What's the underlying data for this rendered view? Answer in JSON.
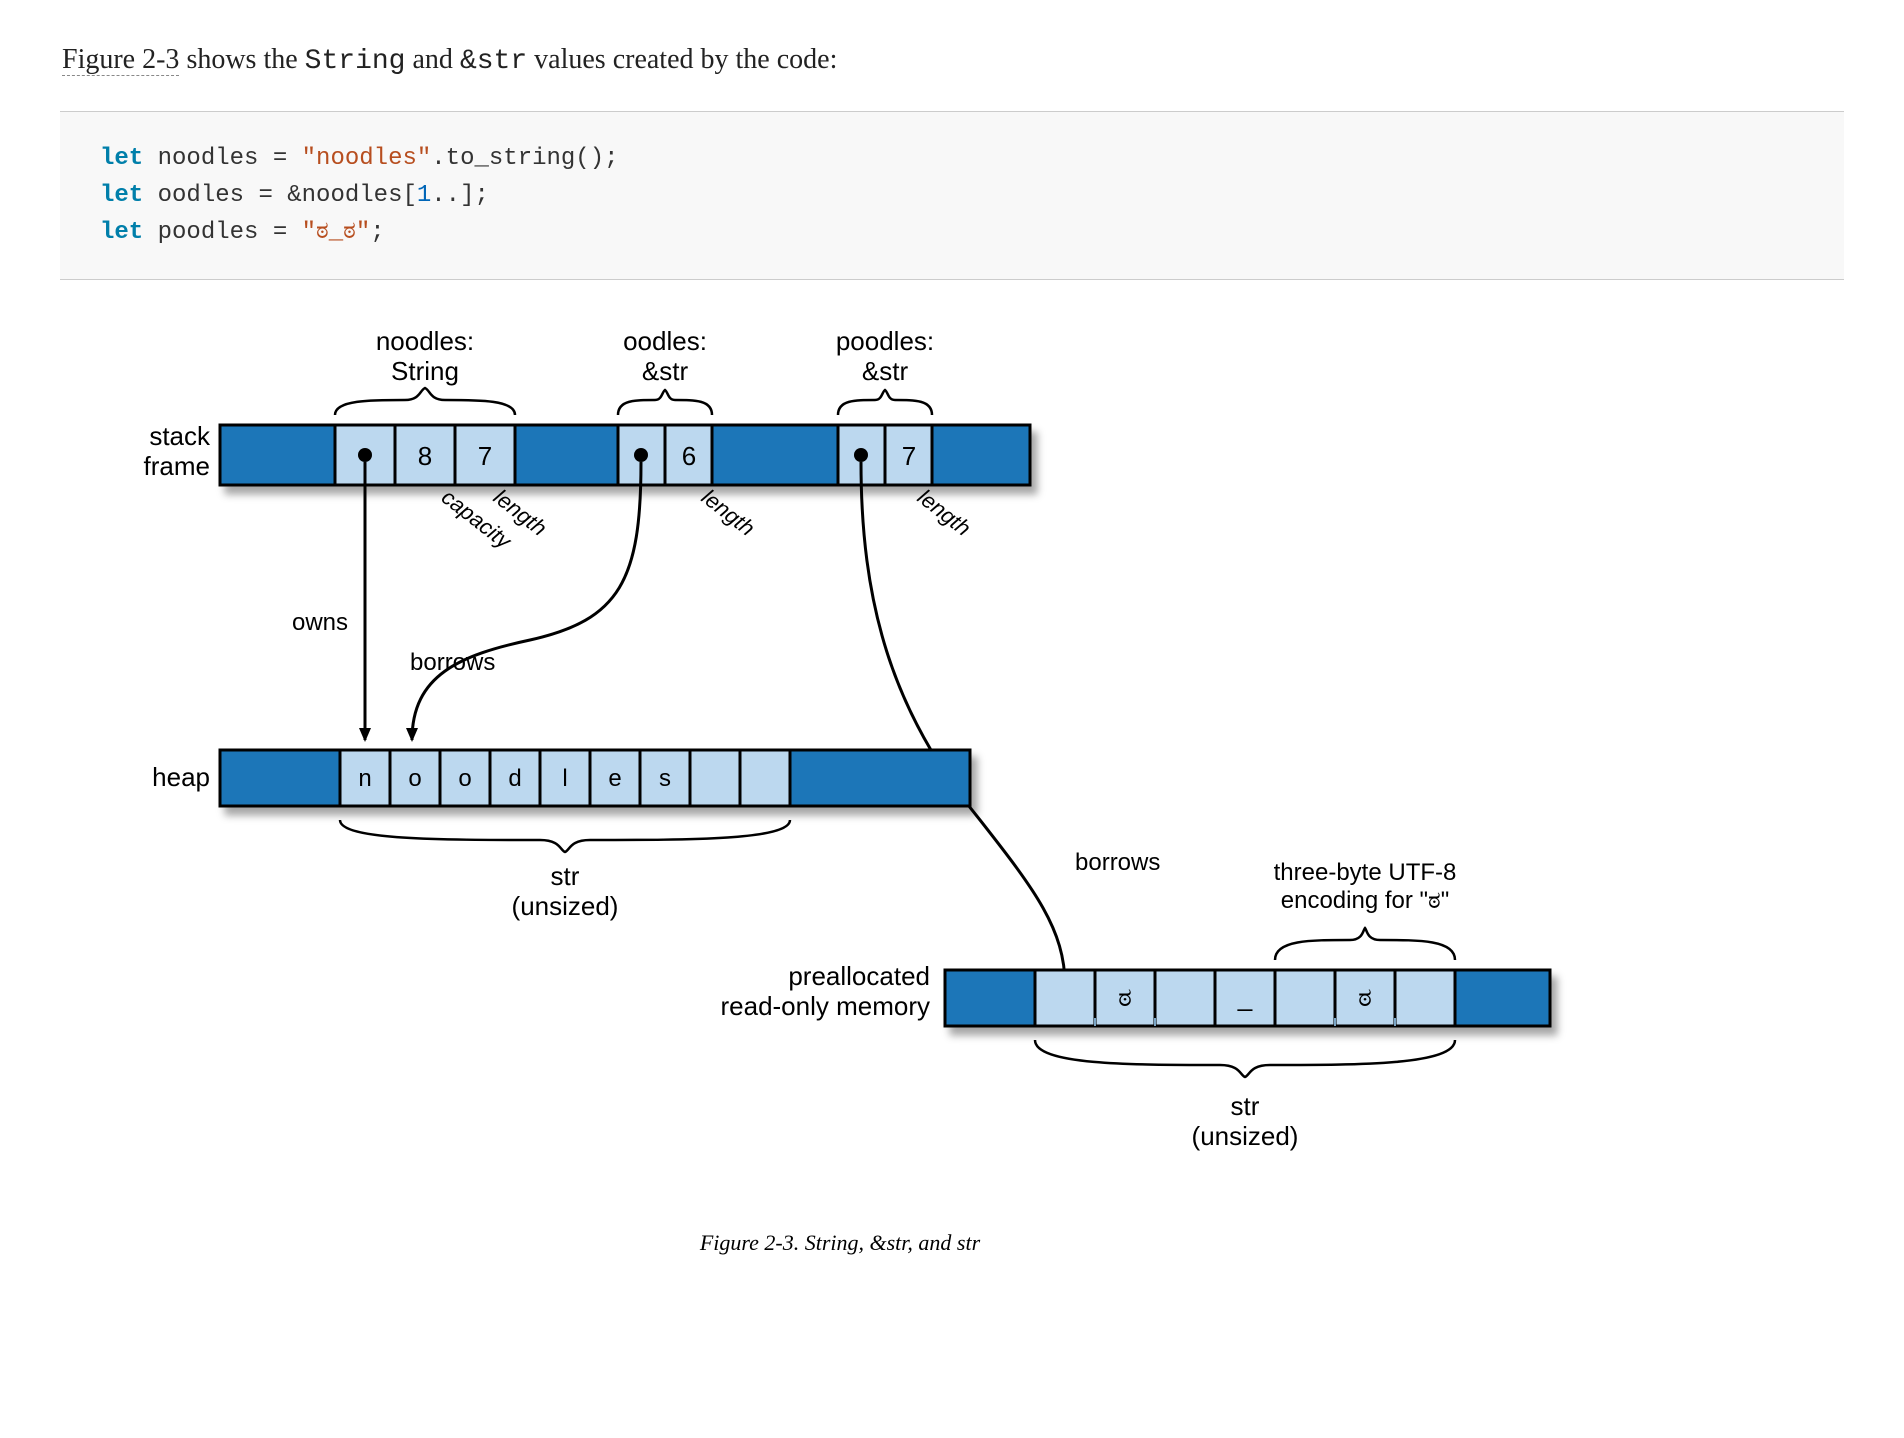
{
  "lead": {
    "prefix_figref": "Figure 2-3",
    "middle_1": " shows the ",
    "code_string": "String",
    "middle_2": " and ",
    "code_str_ref": "&str",
    "suffix": " values created by the code:"
  },
  "code": {
    "l1_kw": "let",
    "l1_ident": " noodles ",
    "l1_eq": "=",
    "l1_sp": " ",
    "l1_str": "\"noodles\"",
    "l1_rest": ".to_string();",
    "l2_kw": "let",
    "l2_ident": " oodles ",
    "l2_eq": "=",
    "l2_sp": " ",
    "l2_amp": "&noodles[",
    "l2_num": "1",
    "l2_rest": "..];",
    "l3_kw": "let",
    "l3_ident": " poodles ",
    "l3_eq": "=",
    "l3_sp": " ",
    "l3_str": "\"ಠ_ಠ\"",
    "l3_semi": ";"
  },
  "diagram": {
    "stack_frame_label_1": "stack",
    "stack_frame_label_2": "frame",
    "labels": {
      "noodles_name": "noodles:",
      "noodles_type": "String",
      "oodles_name": "oodles:",
      "oodles_type": "&str",
      "poodles_name": "poodles:",
      "poodles_type": "&str"
    },
    "noodles": {
      "capacity": "8",
      "length": "7",
      "ptr": "•",
      "cap_label": "capacity",
      "len_label": "length"
    },
    "oodles": {
      "len": "6",
      "ptr": "•",
      "len_label": "length"
    },
    "poodles": {
      "len": "7",
      "ptr": "•",
      "len_label": "length"
    },
    "owns_label": "owns",
    "borrows_label": "borrows",
    "heap_label": "heap",
    "heap_cells": [
      "n",
      "o",
      "o",
      "d",
      "l",
      "e",
      "s",
      "",
      ""
    ],
    "str_unsized_1": "str",
    "str_unsized_2": "(unsized)",
    "preallocated_l1": "preallocated",
    "preallocated_l2": "read-only memory",
    "rom_cells_glyphs": [
      "ಠ",
      "",
      "",
      "_",
      "ಠ",
      "",
      ""
    ],
    "utf8_label_l1": "three-byte UTF-8",
    "utf8_label_l2": "encoding for \"ಠ\"",
    "str2_unsized_1": "str",
    "str2_unsized_2": "(unsized)"
  },
  "caption": "Figure 2-3. String, &str, and str",
  "chart_data": {
    "type": "table",
    "title": "Rust string layout diagram",
    "stack_frame": {
      "noodles": {
        "type": "String",
        "pointer_to": "heap_index_0",
        "capacity": 8,
        "length": 7
      },
      "oodles": {
        "type": "&str",
        "pointer_to": "heap_index_1",
        "length": 6
      },
      "poodles": {
        "type": "&str",
        "pointer_to": "readonly_index_0",
        "length": 7
      }
    },
    "heap": {
      "bytes": [
        "n",
        "o",
        "o",
        "d",
        "l",
        "e",
        "s"
      ],
      "capacity": 8
    },
    "readonly_memory": {
      "note": "preallocated read-only memory",
      "glyphs": [
        "ಠ",
        "_",
        "ಠ"
      ],
      "bytes_per_glyph": {
        "ಠ": 3,
        "_": 1
      },
      "total_bytes": 7
    },
    "str_notes": [
      "str is unsized",
      "three-byte UTF-8 encoding for \"ಠ\""
    ]
  }
}
